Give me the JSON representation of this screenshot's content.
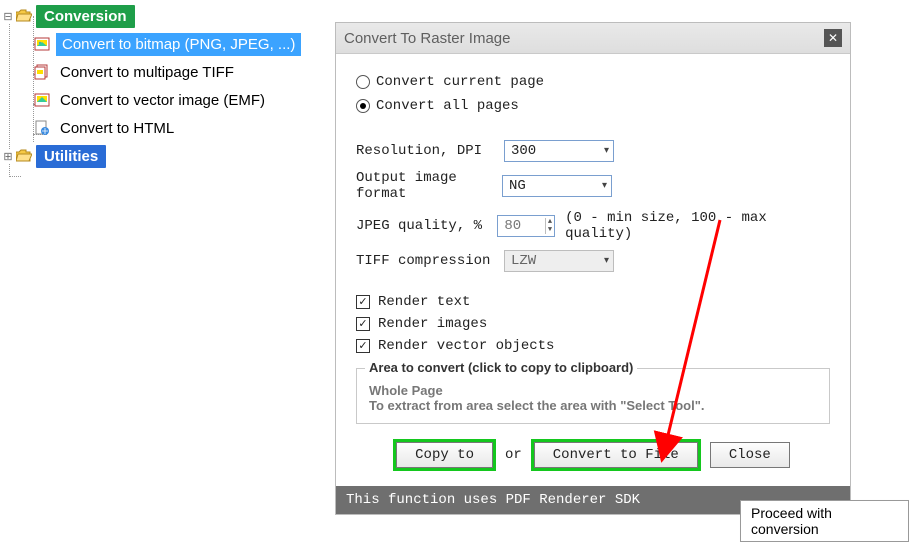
{
  "tree": {
    "conversion_label": "Conversion",
    "items": [
      "Convert to bitmap (PNG, JPEG, ...)",
      "Convert to multipage TIFF",
      "Convert to vector image (EMF)",
      "Convert to HTML"
    ],
    "utilities_label": "Utilities"
  },
  "dialog": {
    "title": "Convert To Raster Image",
    "radio_current": "Convert current page",
    "radio_all": "Convert all pages",
    "resolution_label": "Resolution, DPI",
    "resolution_value": "300",
    "output_format_label": "Output image format",
    "output_format_value": "NG",
    "jpeg_label": "JPEG quality, %",
    "jpeg_value": "80",
    "jpeg_hint": "(0 - min size, 100 - max quality)",
    "tiff_label": "TIFF compression",
    "tiff_value": "LZW",
    "cb_text": "Render text",
    "cb_images": "Render images",
    "cb_vector": "Render vector objects",
    "area_title": "Area to convert (click to copy to clipboard)",
    "area_sub": "Whole Page",
    "area_txt": "To extract from area select the area with \"Select Tool\".",
    "btn_copy": "Copy to",
    "or": "or",
    "btn_convert": "Convert to File",
    "btn_close": "Close",
    "footer": "This function uses PDF Renderer SDK"
  },
  "tooltip": "Proceed with conversion"
}
